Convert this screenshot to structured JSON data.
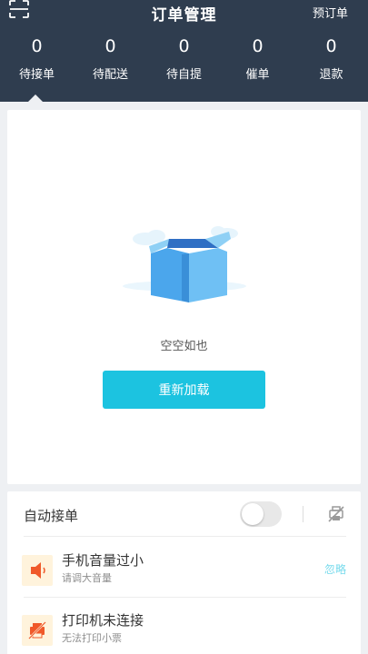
{
  "header": {
    "title": "订单管理",
    "right_action": "预订单",
    "stats": [
      {
        "count": "0",
        "label": "待接单"
      },
      {
        "count": "0",
        "label": "待配送"
      },
      {
        "count": "0",
        "label": "待自提"
      },
      {
        "count": "0",
        "label": "催单"
      },
      {
        "count": "0",
        "label": "退款"
      }
    ]
  },
  "empty_state": {
    "message": "空空如也",
    "reload_label": "重新加载"
  },
  "settings": {
    "auto_accept_label": "自动接单",
    "auto_accept_on": false,
    "alerts": [
      {
        "title": "手机音量过小",
        "subtitle": "请调大音量",
        "action": "忽略"
      },
      {
        "title": "打印机未连接",
        "subtitle": "无法打印小票"
      }
    ]
  },
  "colors": {
    "header_bg": "#2f3d4f",
    "accent": "#1cc3e0",
    "alert_icon": "#f0592a"
  }
}
